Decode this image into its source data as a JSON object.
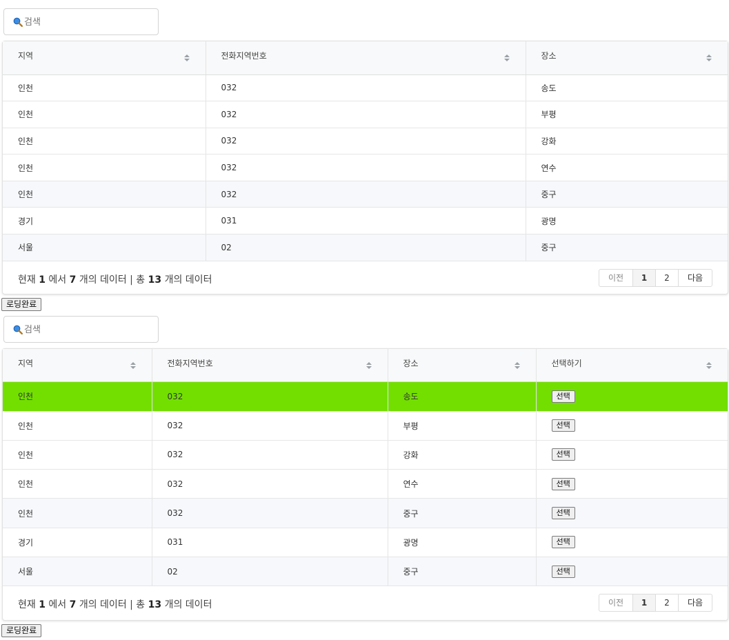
{
  "search": {
    "placeholder": "검색"
  },
  "grid1": {
    "headers": [
      "지역",
      "전화지역번호",
      "장소"
    ],
    "rows": [
      [
        "인천",
        "032",
        "송도"
      ],
      [
        "인천",
        "032",
        "부평"
      ],
      [
        "인천",
        "032",
        "강화"
      ],
      [
        "인천",
        "032",
        "연수"
      ],
      [
        "인천",
        "032",
        "중구"
      ],
      [
        "경기",
        "031",
        "광명"
      ],
      [
        "서울",
        "02",
        "중구"
      ]
    ],
    "footer": {
      "prefix": "현재",
      "from": "1",
      "mid": "에서",
      "to": "7",
      "suffix1": "개의 데이터 | 총",
      "total": "13",
      "suffix2": "개의 데이터"
    },
    "pager": {
      "prev": "이전",
      "page1": "1",
      "page2": "2",
      "next": "다음"
    }
  },
  "status_label": "로딩완료",
  "grid2": {
    "headers": [
      "지역",
      "전화지역번호",
      "장소",
      "선택하기"
    ],
    "select_label": "선택",
    "rows": [
      [
        "인천",
        "032",
        "송도"
      ],
      [
        "인천",
        "032",
        "부평"
      ],
      [
        "인천",
        "032",
        "강화"
      ],
      [
        "인천",
        "032",
        "연수"
      ],
      [
        "인천",
        "032",
        "중구"
      ],
      [
        "경기",
        "031",
        "광명"
      ],
      [
        "서울",
        "02",
        "중구"
      ]
    ],
    "selected_row": 0,
    "footer": {
      "prefix": "현재",
      "from": "1",
      "mid": "에서",
      "to": "7",
      "suffix1": "개의 데이터 | 총",
      "total": "13",
      "suffix2": "개의 데이터"
    },
    "pager": {
      "prev": "이전",
      "page1": "1",
      "page2": "2",
      "next": "다음"
    }
  },
  "colors": {
    "selected_row": "#72df00",
    "header_bg": "#f8f9fa",
    "alt_row": "#f6f8fb"
  },
  "icons": {
    "search": "search-icon",
    "sort": "sort-icon"
  }
}
